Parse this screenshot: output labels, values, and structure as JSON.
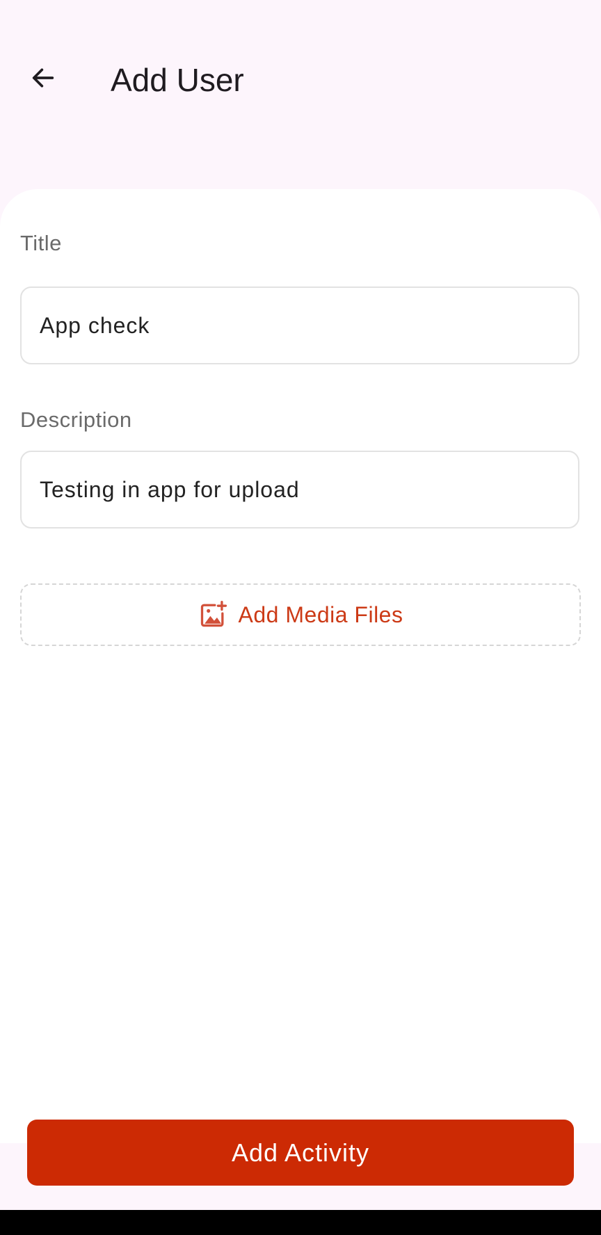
{
  "header": {
    "title": "Add User",
    "back_icon": "arrow-left-icon"
  },
  "form": {
    "title_label": "Title",
    "title_value": "App check",
    "description_label": "Description",
    "description_value": "Testing in app for upload",
    "media_label": "Add Media Files",
    "media_icon": "add-image-icon"
  },
  "footer": {
    "submit_label": "Add Activity"
  },
  "colors": {
    "background": "#fdf5fc",
    "accent": "#cc2a04",
    "accent_text": "#cc3a16",
    "text_primary": "#1f1b20",
    "label_text": "#6a6a6a",
    "field_border": "#e2e2e2",
    "nav_bar": "#000000"
  }
}
